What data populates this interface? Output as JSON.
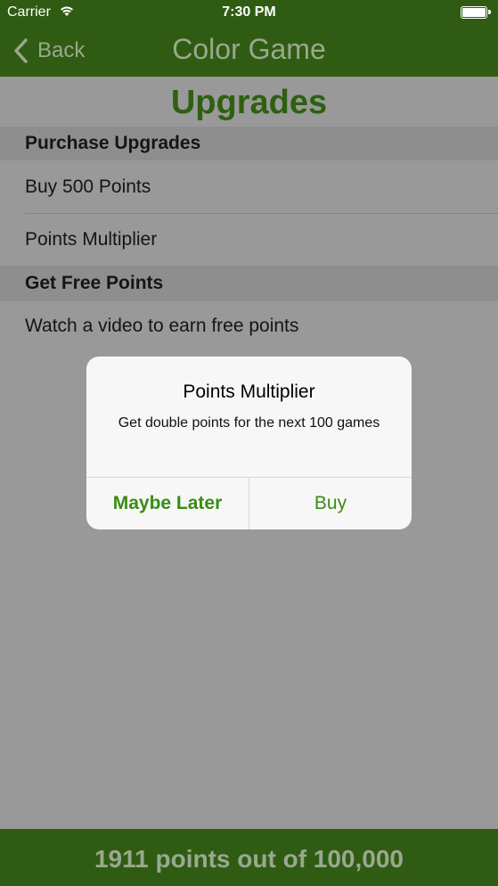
{
  "status_bar": {
    "carrier": "Carrier",
    "time": "7:30 PM",
    "wifi_icon": "wifi-icon",
    "battery_icon": "battery-icon",
    "battery_level": 1.0
  },
  "nav_bar": {
    "back_label": "Back",
    "back_icon": "chevron-left-icon",
    "title": "Color Game",
    "background_color": "#2f5c12"
  },
  "page": {
    "title": "Upgrades",
    "title_color": "#2d6010"
  },
  "sections": [
    {
      "header": "Purchase Upgrades",
      "rows": [
        "Buy 500 Points",
        "Points Multiplier"
      ]
    },
    {
      "header": "Get Free Points",
      "rows": [
        "Watch a video to earn free points"
      ]
    }
  ],
  "alert": {
    "title": "Points Multiplier",
    "message": "Get double points for the next 100 games",
    "buttons": [
      {
        "label": "Maybe Later",
        "bold": true
      },
      {
        "label": "Buy",
        "bold": false
      }
    ],
    "button_color": "#3a8c12"
  },
  "footer": {
    "text": "1911 points out of 100,000"
  }
}
